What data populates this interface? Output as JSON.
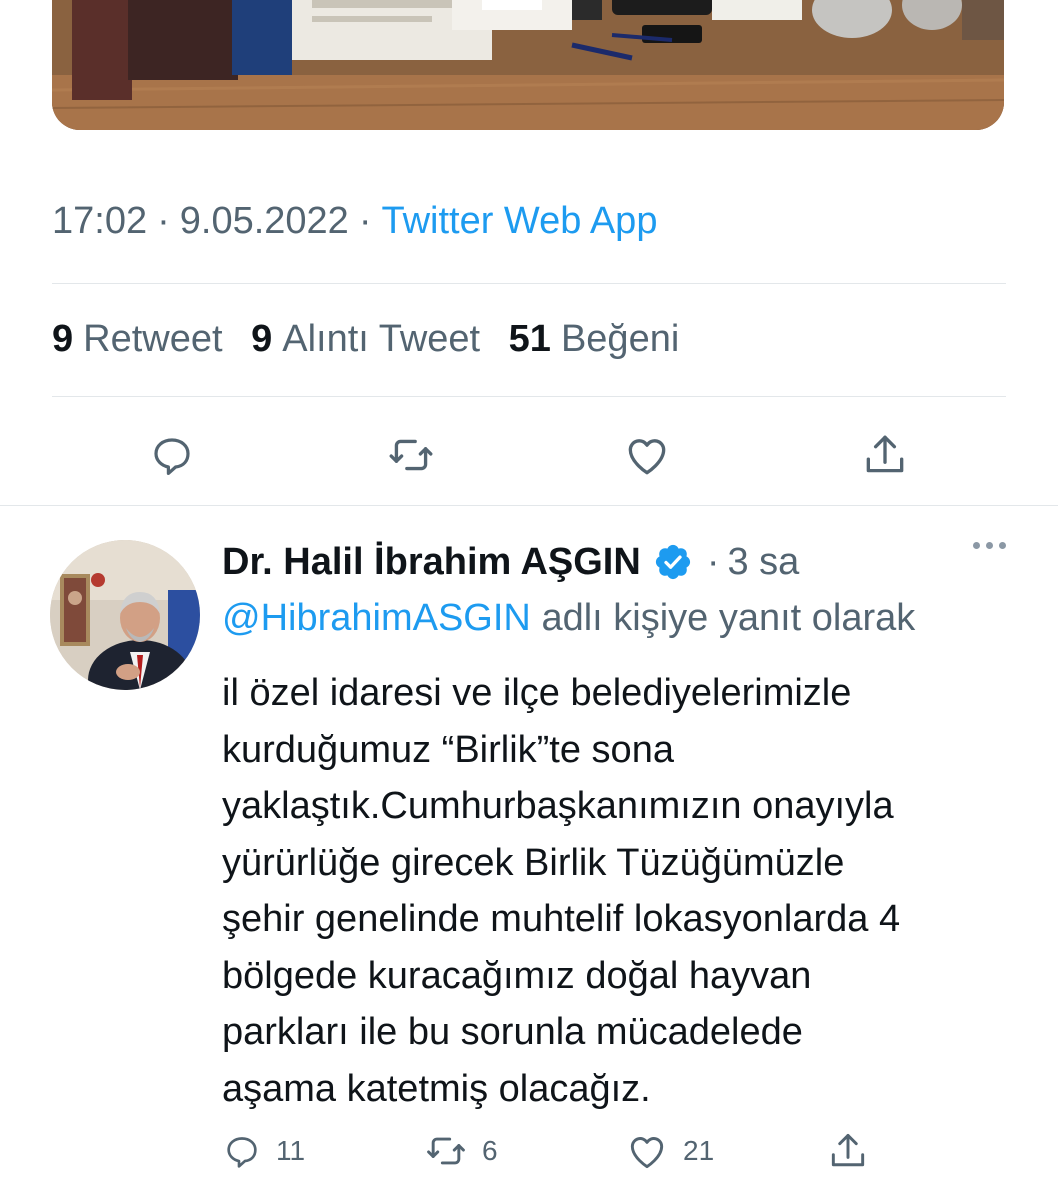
{
  "tweet": {
    "time": "17:02",
    "date": "9.05.2022",
    "source": "Twitter Web App",
    "separator": "·",
    "stats": [
      {
        "count": "9",
        "label": "Retweet"
      },
      {
        "count": "9",
        "label": "Alıntı Tweet"
      },
      {
        "count": "51",
        "label": "Beğeni"
      }
    ],
    "actions": [
      "reply-icon",
      "retweet-icon",
      "like-icon",
      "share-icon"
    ]
  },
  "reply": {
    "author": "Dr. Halil İbrahim AŞGIN",
    "verified": true,
    "separator": "·",
    "time": "3 sa",
    "replying_to_handle": "@HibrahimASGIN",
    "replying_to_suffix": "adlı kişiye yanıt olarak",
    "text_lines": [
      "il özel idaresi ve ilçe belediyelerimizle",
      "kurduğumuz “Birlik”te sona",
      "yaklaştık.Cumhurbaşkanımızın onayıyla",
      "yürürlüğe girecek Birlik Tüzüğümüzle",
      "şehir genelinde muhtelif lokasyonlarda 4",
      "bölgede kuracağımız doğal hayvan",
      "parkları ile bu sorunla mücadelede",
      "aşama katetmiş olacağız."
    ],
    "counts": {
      "replies": "11",
      "retweets": "6",
      "likes": "21"
    }
  },
  "colors": {
    "text": "#0f1419",
    "secondary": "#536471",
    "accent": "#1d9bf0",
    "divider": "#e3e7ea"
  }
}
